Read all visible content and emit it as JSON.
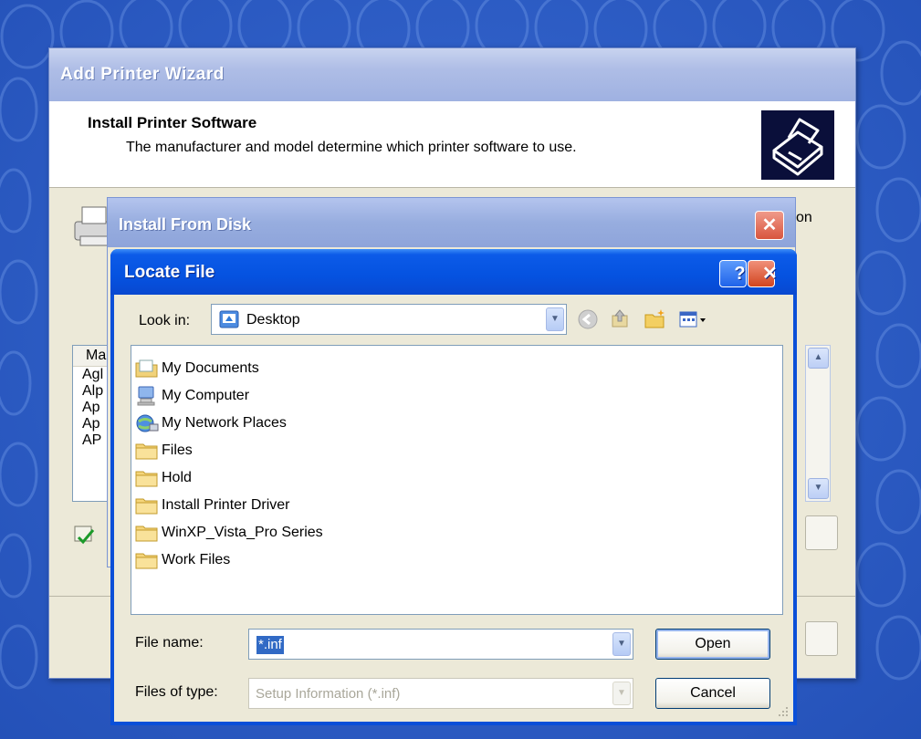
{
  "wizard": {
    "title": "Add Printer Wizard",
    "heading": "Install Printer Software",
    "subheading": "The manufacturer and model determine which printer software to use.",
    "right_text_fragment": "on",
    "list_header": "Ma",
    "list_items": [
      "Agl",
      "Alp",
      "Ap",
      "Ap",
      "AP",
      "..."
    ]
  },
  "install_from_disk": {
    "title": "Install From Disk",
    "close_glyph": "✕"
  },
  "locate_file": {
    "title": "Locate File",
    "help_glyph": "?",
    "close_glyph": "✕",
    "look_in_label": "Look in:",
    "look_in_value": "Desktop",
    "toolbar_icons": [
      "back-icon",
      "up-folder-icon",
      "new-folder-icon",
      "view-menu-icon"
    ],
    "files": [
      {
        "name": "My Documents",
        "icon": "my-documents-icon"
      },
      {
        "name": "My Computer",
        "icon": "my-computer-icon"
      },
      {
        "name": "My Network Places",
        "icon": "network-places-icon"
      },
      {
        "name": "Files",
        "icon": "folder-icon"
      },
      {
        "name": "Hold",
        "icon": "folder-icon"
      },
      {
        "name": "Install Printer Driver",
        "icon": "folder-icon"
      },
      {
        "name": "WinXP_Vista_Pro Series",
        "icon": "folder-icon"
      },
      {
        "name": "Work Files",
        "icon": "folder-icon"
      }
    ],
    "file_name_label": "File name:",
    "file_name_value": "*.inf",
    "files_of_type_label": "Files of type:",
    "files_of_type_value": "Setup Information (*.inf)",
    "open_label": "Open",
    "cancel_label": "Cancel"
  }
}
